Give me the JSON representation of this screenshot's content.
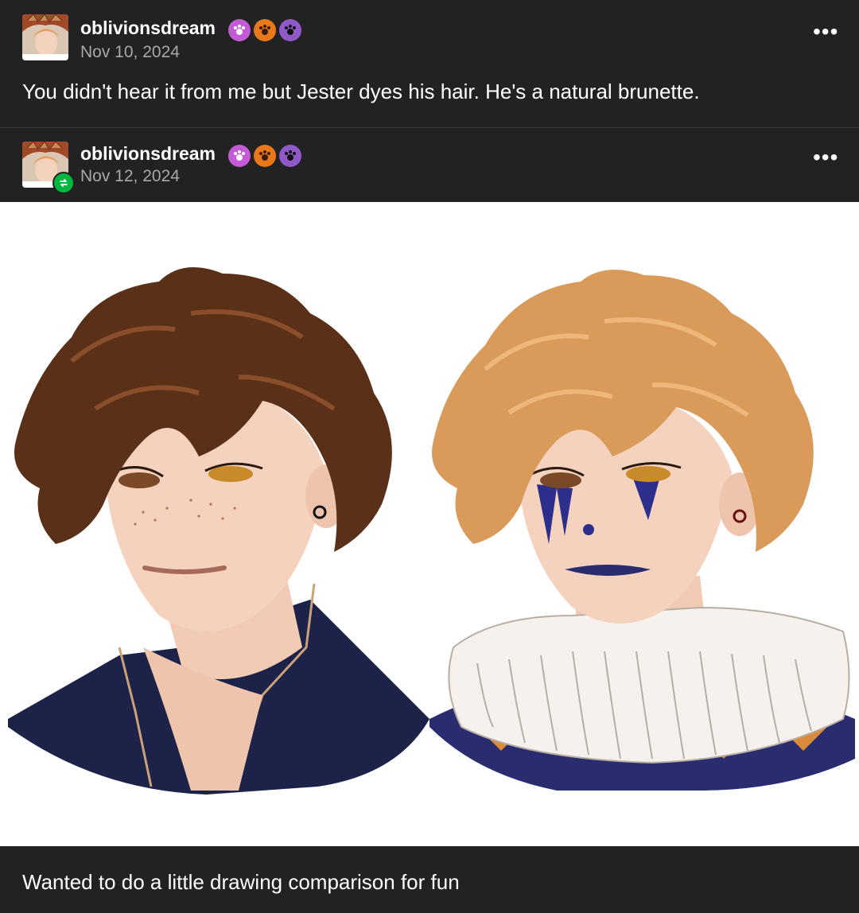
{
  "posts": [
    {
      "username": "oblivionsdream",
      "date": "Nov 10, 2024",
      "text": "You didn't hear it from me but Jester dyes his hair. He's a natural brunette.",
      "badges": [
        "paw-badge-pink",
        "paw-badge-orange",
        "paw-badge-purple"
      ]
    },
    {
      "username": "oblivionsdream",
      "date": "Nov 12, 2024",
      "reblog": true,
      "badges": [
        "paw-badge-pink",
        "paw-badge-orange",
        "paw-badge-purple"
      ]
    }
  ],
  "more_label": "•••",
  "caption": "Wanted to do a little drawing comparison for fun",
  "colors": {
    "background": "#222222",
    "username": "#ffffff",
    "date": "#a8a8a8",
    "reblog_green": "#00b83f",
    "badge_pink": "#c45bd6",
    "badge_orange": "#e8781a",
    "badge_purple": "#8f5ac8",
    "brown_hair": "#5a3018",
    "blond_hair": "#d99a5a",
    "navy": "#1c2248"
  }
}
